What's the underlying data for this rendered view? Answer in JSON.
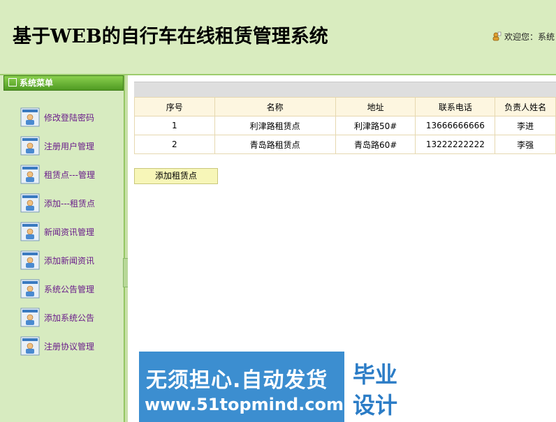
{
  "header": {
    "title": "基于WEB的自行车在线租赁管理系统",
    "welcome": "欢迎您：系统"
  },
  "sidebar": {
    "title": "系统菜单",
    "items": [
      {
        "label": "修改登陆密码"
      },
      {
        "label": "注册用户管理"
      },
      {
        "label": "租赁点---管理"
      },
      {
        "label": "添加---租赁点"
      },
      {
        "label": "新闻资讯管理"
      },
      {
        "label": "添加新闻资讯"
      },
      {
        "label": "系统公告管理"
      },
      {
        "label": "添加系统公告"
      },
      {
        "label": "注册协议管理"
      }
    ]
  },
  "table": {
    "columns": [
      "序号",
      "名称",
      "地址",
      "联系电话",
      "负责人姓名"
    ],
    "rows": [
      [
        "1",
        "利津路租赁点",
        "利津路50#",
        "13666666666",
        "李进"
      ],
      [
        "2",
        "青岛路租赁点",
        "青岛路60#",
        "13222222222",
        "李强"
      ]
    ]
  },
  "actions": {
    "add_label": "添加租赁点"
  },
  "banner": {
    "line1": "无须担心.自动发货",
    "line2": "www.51topmind.com",
    "right1": "毕业",
    "right2": "设计"
  }
}
